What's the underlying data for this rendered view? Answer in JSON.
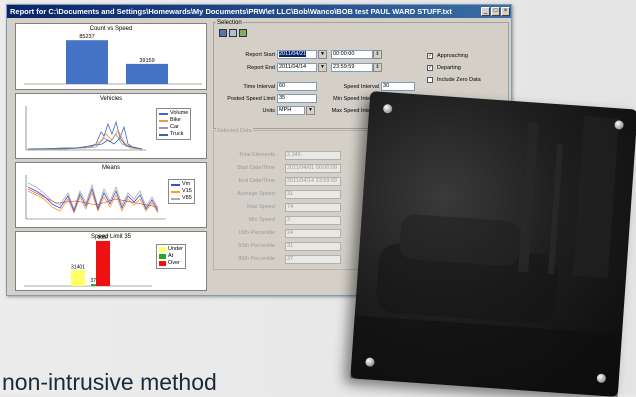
{
  "window": {
    "title": "Report for C:\\Documents and Settings\\Homewards\\My Documents\\PRW\\et LLC\\Bob\\Wanco\\BOB test PAUL WARD STUFF.txt"
  },
  "tagline": "non-intrusive method",
  "charts": [
    {
      "title": "Count vs Speed",
      "type": "bar",
      "values": [
        85237,
        39159
      ],
      "value_labels": [
        "85237",
        "39159"
      ],
      "color": "#4472c4"
    },
    {
      "title": "Vehicles",
      "type": "line",
      "legend": [
        {
          "name": "Volume",
          "color": "#4466cc"
        },
        {
          "name": "Bike",
          "color": "#ee9933"
        },
        {
          "name": "Car",
          "color": "#999999"
        },
        {
          "name": "Truck",
          "color": "#3366aa"
        }
      ]
    },
    {
      "title": "Means",
      "type": "line",
      "legend": [
        {
          "name": "Vm",
          "color": "#3355cc"
        },
        {
          "name": "V15",
          "color": "#ff9933"
        },
        {
          "name": "V85",
          "color": "#aaaaaa"
        }
      ]
    },
    {
      "title": "Speed Limit 35",
      "type": "bar",
      "values": [
        31401,
        3718,
        90000
      ],
      "value_labels": [
        "31401",
        "3718",
        "9657"
      ],
      "legend": [
        {
          "name": "Under",
          "color": "#ffff66"
        },
        {
          "name": "At",
          "color": "#22aa22"
        },
        {
          "name": "Over",
          "color": "#ee1111"
        }
      ]
    }
  ],
  "selection": {
    "group_label": "Selection",
    "report_start_label": "Report Start",
    "report_start_date": "2011/04/21",
    "report_start_time": "00:00:00",
    "report_end_label": "Report End",
    "report_end_date": "2011/04/14",
    "report_end_time": "23:59:59",
    "time_interval_label": "Time Interval",
    "time_interval": "60",
    "speed_interval_label": "Speed Interval",
    "speed_interval": "30",
    "posted_speed_label": "Posted Speed Limit",
    "posted_speed": "35",
    "min_speed_label": "Min Speed Interval",
    "min_speed": "20",
    "units_label": "Units",
    "units": "MPH",
    "max_speed_label": "Max Speed Interval",
    "max_speed": "80",
    "approaching": "Approaching",
    "departing": "Departing",
    "include_zero": "Include Zero Data"
  },
  "stats": {
    "group_label": "Selected Data",
    "rows": [
      {
        "label": "Total Elements",
        "value": "2,345"
      },
      {
        "label": "Start Date/Time",
        "value": "2011/04/01 00:00:00"
      },
      {
        "label": "End Date/Time",
        "value": "2011/04/14 23:59:59"
      },
      {
        "label": "Average Speed",
        "value": "31"
      },
      {
        "label": "Max Speed",
        "value": "74"
      },
      {
        "label": "Min Speed",
        "value": "3"
      },
      {
        "label": "15th Percentile",
        "value": "24"
      },
      {
        "label": "50th Percentile",
        "value": "31"
      },
      {
        "label": "85th Percentile",
        "value": "37"
      }
    ]
  }
}
